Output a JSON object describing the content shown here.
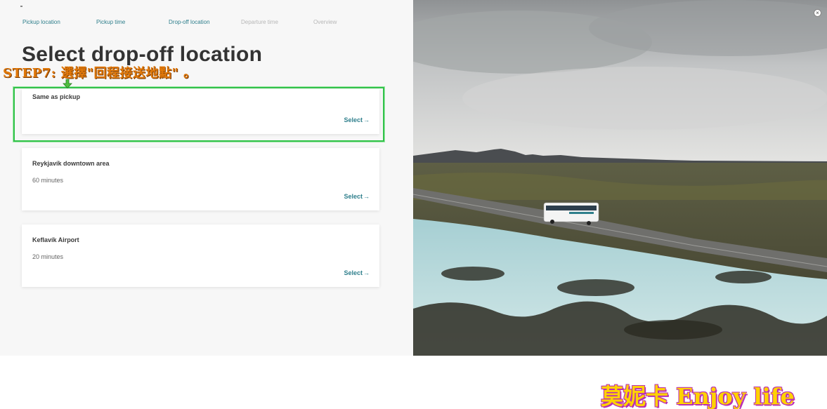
{
  "steps": [
    {
      "label": "Pickup location",
      "state": "done"
    },
    {
      "label": "Pickup time",
      "state": "done"
    },
    {
      "label": "Drop-off location",
      "state": "current"
    },
    {
      "label": "Departure time",
      "state": "future"
    },
    {
      "label": "Overview",
      "state": "future"
    }
  ],
  "page_title": "Select drop-off location",
  "annotation": "STEP7: 選擇\"回程接送地點\" 。",
  "options": [
    {
      "title": "Same as pickup",
      "subtitle": "",
      "select_label": "Select"
    },
    {
      "title": "Reykjavík downtown area",
      "subtitle": "60 minutes",
      "select_label": "Select"
    },
    {
      "title": "Keflavík Airport",
      "subtitle": "20 minutes",
      "select_label": "Select"
    }
  ],
  "close_symbol": "×",
  "watermark": "莫妮卡 Enjoy life",
  "icons": {
    "close": "close-icon",
    "arrow": "arrow-right-icon",
    "annotation_arrow": "down-arrow-icon"
  },
  "colors": {
    "accent": "#2f7f8c",
    "highlight": "#32c24a",
    "annotation": "#e0780a",
    "watermark": "#ffd200"
  }
}
